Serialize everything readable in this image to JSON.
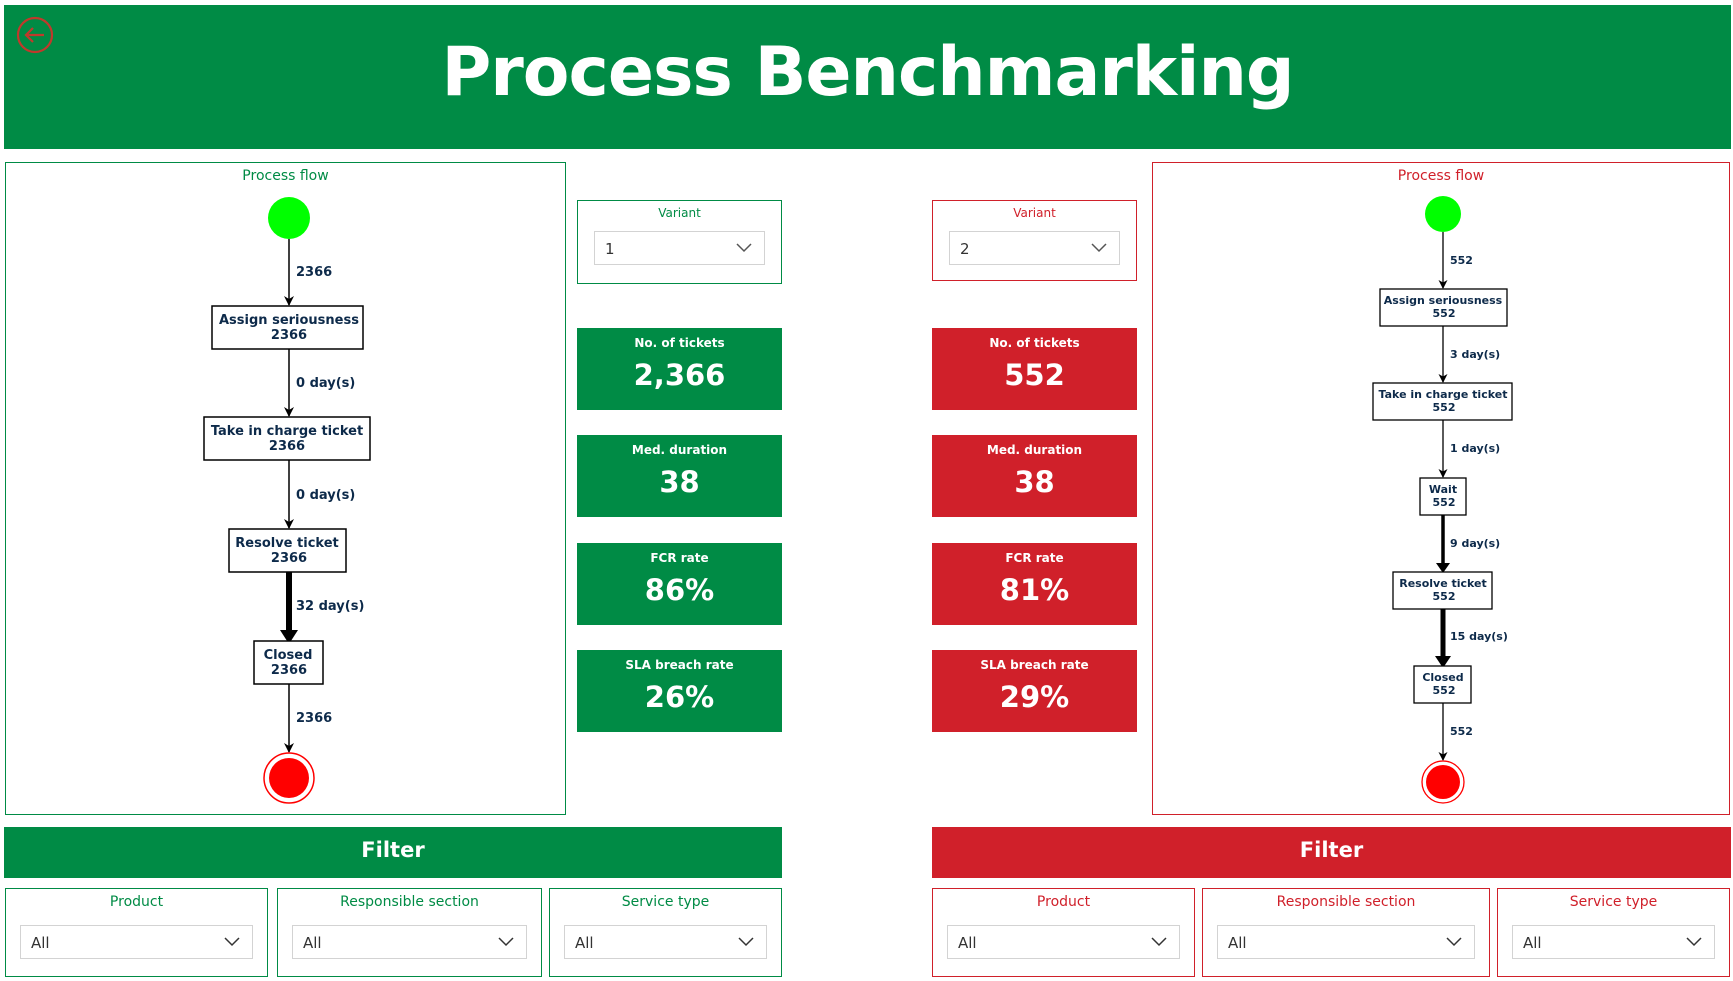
{
  "header": {
    "title": "Process Benchmarking"
  },
  "colors": {
    "green": "#008b45",
    "red": "#d0202a",
    "start_node": "#00ff00",
    "end_node": "#ff0000"
  },
  "icons": {
    "back": "arrow-left-circle-icon",
    "dropdown": "chevron-down-icon"
  },
  "left": {
    "process_flow": {
      "title": "Process flow",
      "nodes": [
        {
          "label": "Assign seriousness",
          "count": "2366"
        },
        {
          "label": "Take in charge ticket",
          "count": "2366"
        },
        {
          "label": "Resolve ticket",
          "count": "2366"
        },
        {
          "label": "Closed",
          "count": "2366"
        }
      ],
      "edges": [
        "2366",
        "0 day(s)",
        "0 day(s)",
        "32 day(s)",
        "2366"
      ]
    },
    "variant": {
      "label": "Variant",
      "value": "1"
    },
    "kpis": [
      {
        "label": "No. of tickets",
        "value": "2,366"
      },
      {
        "label": "Med. duration",
        "value": "38"
      },
      {
        "label": "FCR rate",
        "value": "86%"
      },
      {
        "label": "SLA breach rate",
        "value": "26%"
      }
    ],
    "filter": {
      "title": "Filter",
      "slicers": [
        {
          "label": "Product",
          "value": "All"
        },
        {
          "label": "Responsible section",
          "value": "All"
        },
        {
          "label": "Service type",
          "value": "All"
        }
      ]
    }
  },
  "right": {
    "process_flow": {
      "title": "Process flow",
      "nodes": [
        {
          "label": "Assign seriousness",
          "count": "552"
        },
        {
          "label": "Take in charge ticket",
          "count": "552"
        },
        {
          "label": "Wait",
          "count": "552"
        },
        {
          "label": "Resolve ticket",
          "count": "552"
        },
        {
          "label": "Closed",
          "count": "552"
        }
      ],
      "edges": [
        "552",
        "3 day(s)",
        "1 day(s)",
        "9 day(s)",
        "15 day(s)",
        "552"
      ]
    },
    "variant": {
      "label": "Variant",
      "value": "2"
    },
    "kpis": [
      {
        "label": "No. of tickets",
        "value": "552"
      },
      {
        "label": "Med. duration",
        "value": "38"
      },
      {
        "label": "FCR rate",
        "value": "81%"
      },
      {
        "label": "SLA breach rate",
        "value": "29%"
      }
    ],
    "filter": {
      "title": "Filter",
      "slicers": [
        {
          "label": "Product",
          "value": "All"
        },
        {
          "label": "Responsible section",
          "value": "All"
        },
        {
          "label": "Service type",
          "value": "All"
        }
      ]
    }
  }
}
